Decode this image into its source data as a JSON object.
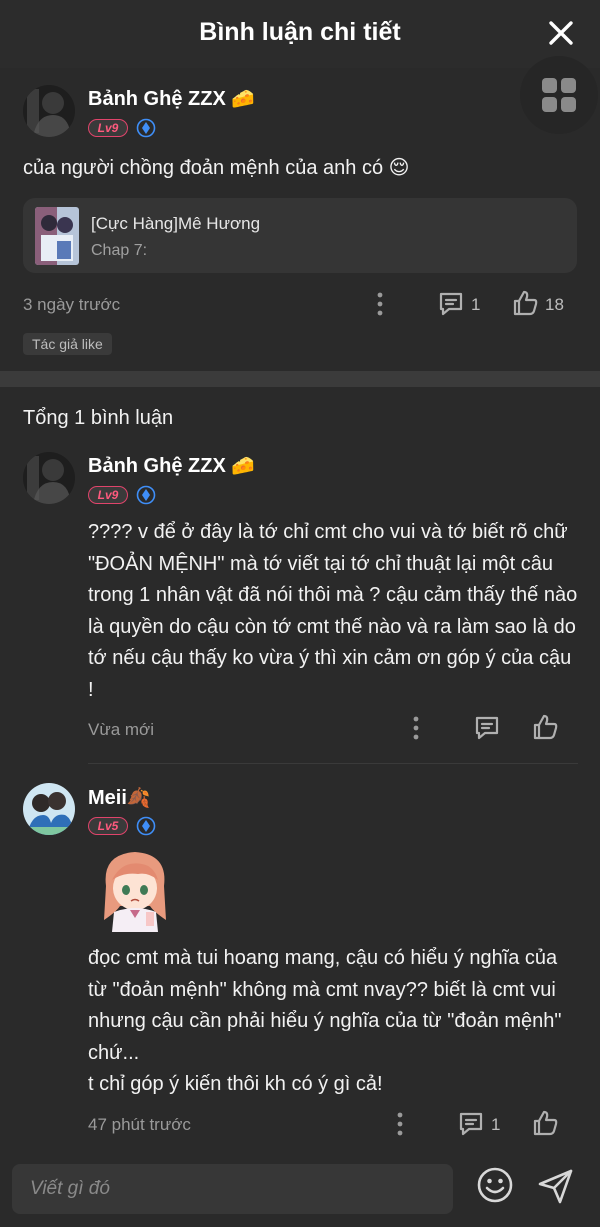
{
  "header": {
    "title": "Bình luận chi tiết"
  },
  "main_comment": {
    "username": "Bảnh Ghệ ZZX",
    "username_emoji": "🧀",
    "level": "Lv9",
    "text": "của người chồng đoản mệnh của anh có 😌",
    "chapter_card": {
      "title": "[Cực Hàng]Mê Hương",
      "subtitle": "Chap 7:"
    },
    "time": "3 ngày trước",
    "reply_count": "1",
    "like_count": "18",
    "author_tag": "Tác giả like"
  },
  "replies_header": "Tổng 1 bình luận",
  "replies": [
    {
      "username": "Bảnh Ghệ ZZX",
      "username_emoji": "🧀",
      "level": "Lv9",
      "text": "???? v để ở đây là tớ chỉ cmt cho vui và tớ biết rõ chữ \"ĐOẢN MỆNH\" mà tớ viết tại tớ chỉ thuật lại một câu trong 1 nhân vật đã nói thôi mà ? cậu cảm thấy thế nào là quyền do cậu còn tớ cmt thế nào và ra làm sao là do tớ nếu cậu thấy ko vừa ý thì xin cảm ơn góp ý của cậu !",
      "time": "Vừa mới"
    },
    {
      "username": "Meii",
      "username_emoji": "🍂",
      "level": "Lv5",
      "text": "đọc cmt mà tui hoang mang, cậu có hiểu ý nghĩa của từ \"đoản mệnh\" không mà cmt nvay?? biết là cmt vui nhưng cậu cần phải hiểu ý nghĩa của từ \"đoản mệnh\" chứ...\nt chỉ góp ý kiến thôi kh có ý gì cả!",
      "time": "47 phút trước",
      "reply_count": "1"
    }
  ],
  "composer": {
    "placeholder": "Viết gì đó"
  },
  "colors": {
    "background": "#2a2a2a",
    "level_badge": "#ff5a7e",
    "verify_icon": "#3f8ef7"
  }
}
